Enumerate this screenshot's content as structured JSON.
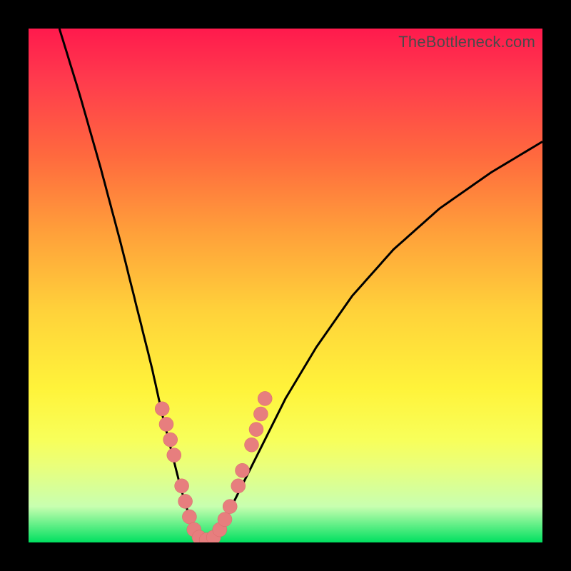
{
  "watermark": "TheBottleneck.com",
  "colors": {
    "frame": "#000000",
    "gradient_top": "#ff1a4d",
    "gradient_bottom": "#00e060",
    "curve": "#000000",
    "dots": "#e77e7e"
  },
  "chart_data": {
    "type": "line",
    "title": "",
    "xlabel": "",
    "ylabel": "",
    "xlim": [
      0,
      100
    ],
    "ylim": [
      0,
      100
    ],
    "grid": false,
    "legend": false,
    "note": "V-shaped bottleneck curve; axes unlabeled; values estimated from pixel positions on a 0–100 normalized scale (y increases upward).",
    "series": [
      {
        "name": "left-branch",
        "x": [
          6,
          10,
          14,
          18,
          21,
          24,
          26,
          28,
          29.5,
          31,
          32.5,
          34
        ],
        "y": [
          100,
          87,
          73,
          58,
          46,
          34,
          25,
          17,
          11,
          6,
          2,
          0
        ]
      },
      {
        "name": "right-branch",
        "x": [
          34,
          38,
          41,
          45,
          50,
          56,
          63,
          71,
          80,
          90,
          100
        ],
        "y": [
          0,
          4,
          10,
          18,
          28,
          38,
          48,
          57,
          65,
          72,
          78
        ]
      }
    ],
    "markers": {
      "name": "highlight-dots",
      "note": "Salmon dots clustered near the trough on both branches",
      "points": [
        {
          "x": 26.0,
          "y": 26
        },
        {
          "x": 26.8,
          "y": 23
        },
        {
          "x": 27.6,
          "y": 20
        },
        {
          "x": 28.3,
          "y": 17
        },
        {
          "x": 29.8,
          "y": 11
        },
        {
          "x": 30.5,
          "y": 8
        },
        {
          "x": 31.3,
          "y": 5
        },
        {
          "x": 32.2,
          "y": 2.5
        },
        {
          "x": 33.2,
          "y": 1
        },
        {
          "x": 34.6,
          "y": 0.5
        },
        {
          "x": 36.0,
          "y": 1
        },
        {
          "x": 37.2,
          "y": 2.5
        },
        {
          "x": 38.2,
          "y": 4.5
        },
        {
          "x": 39.2,
          "y": 7
        },
        {
          "x": 40.8,
          "y": 11
        },
        {
          "x": 41.6,
          "y": 14
        },
        {
          "x": 43.4,
          "y": 19
        },
        {
          "x": 44.3,
          "y": 22
        },
        {
          "x": 45.2,
          "y": 25
        },
        {
          "x": 46.0,
          "y": 28
        }
      ]
    }
  }
}
